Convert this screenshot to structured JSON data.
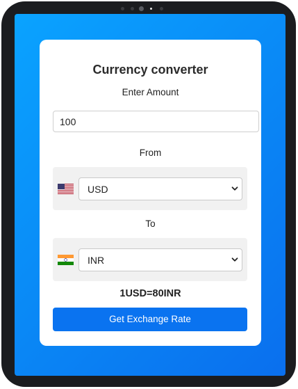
{
  "converter": {
    "title": "Currency converter",
    "amount_label": "Enter Amount",
    "amount_value": "100",
    "from_label": "From",
    "to_label": "To",
    "from_currency": "USD",
    "to_currency": "INR",
    "from_flag_icon": "us-flag-icon",
    "to_flag_icon": "india-flag-icon",
    "result_text": "1USD=80INR",
    "button_label": "Get Exchange Rate"
  },
  "colors": {
    "screen_gradient_start": "#0aa3ff",
    "screen_gradient_end": "#0a6fee",
    "button": "#0a73f0",
    "device_frame": "#1b1c1f"
  }
}
